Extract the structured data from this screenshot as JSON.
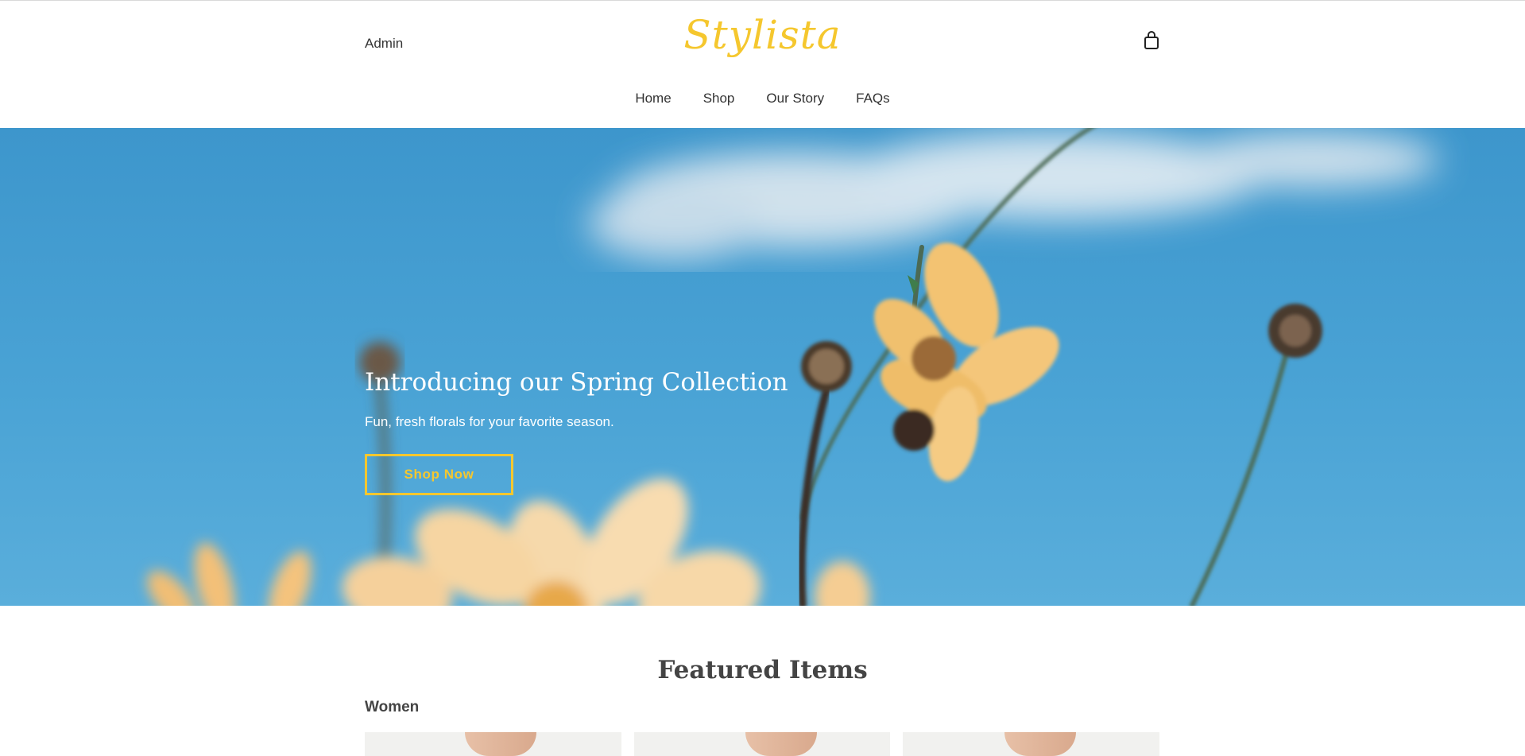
{
  "header": {
    "admin_label": "Admin",
    "logo_text": "Stylista",
    "cart_icon": "shopping-bag-icon",
    "nav": [
      {
        "label": "Home"
      },
      {
        "label": "Shop"
      },
      {
        "label": "Our Story"
      },
      {
        "label": "FAQs"
      }
    ]
  },
  "hero": {
    "title": "Introducing our Spring Collection",
    "subtitle": "Fun, fresh florals for your favorite season.",
    "cta_label": "Shop Now"
  },
  "featured": {
    "title": "Featured Items",
    "category": "Women",
    "products": [
      {
        "image": "product-image"
      },
      {
        "image": "product-image"
      },
      {
        "image": "product-image"
      }
    ]
  },
  "colors": {
    "accent": "#f5c72e",
    "sky": "#4aa3d5",
    "text": "#333333"
  }
}
